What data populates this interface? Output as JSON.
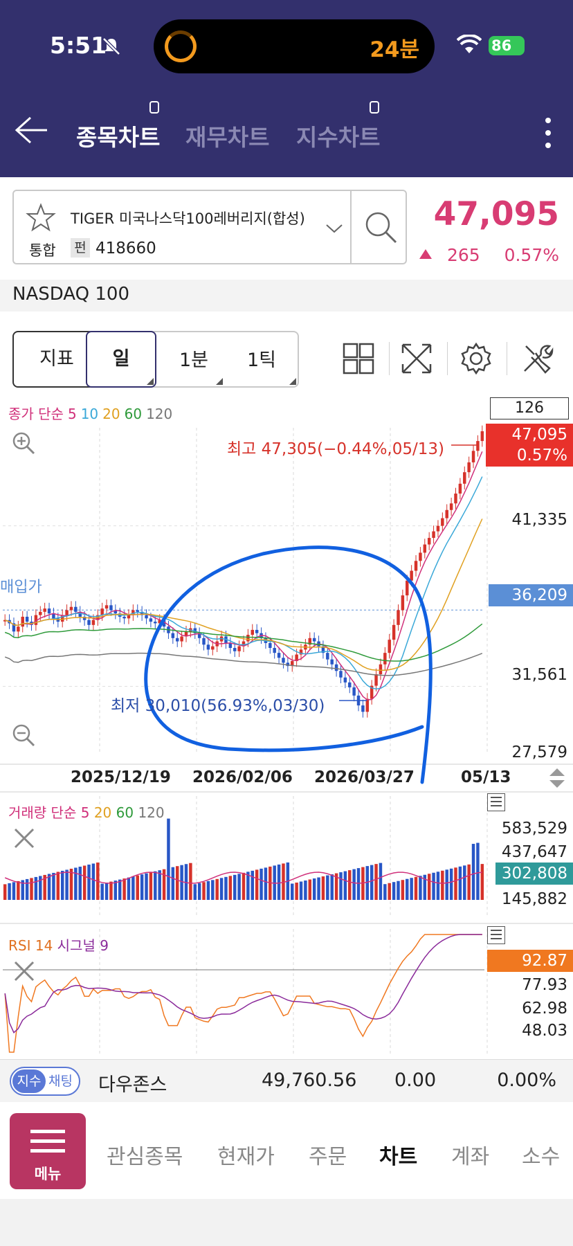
{
  "status": {
    "time": "5:51",
    "island_text": "24분",
    "battery": "86"
  },
  "header": {
    "tabs": [
      {
        "label": "종목차트"
      },
      {
        "label": "재무차트"
      },
      {
        "label": "지수차트"
      }
    ]
  },
  "stock": {
    "name": "TIGER 미국나스닥100레버리지(합성)",
    "market": "통합",
    "fund_badge": "펀",
    "code": "418660",
    "price": "47,095",
    "change": "265",
    "change_pct": "0.57%",
    "index_name": "NASDAQ 100"
  },
  "toolbar": {
    "indicator": "지표",
    "day": "일",
    "minute": "1분",
    "tick": "1틱"
  },
  "chart": {
    "legend": {
      "prefix": "종가 단순",
      "ma": [
        "5",
        "10",
        "20",
        "60",
        "120"
      ]
    },
    "count": "126",
    "high_label": "최고 47,305(−0.44%,05/13)",
    "low_label": "최저 30,010(56.93%,03/30)",
    "avg_label": "매입가",
    "price_tag": "47,095",
    "pct_tag": "0.57%",
    "avg_tag": "36,209",
    "y_ticks": [
      "41,335",
      "31,561",
      "27,579"
    ],
    "dates": [
      "2025/12/19",
      "2026/02/06",
      "2026/03/27",
      "05/13"
    ]
  },
  "volume": {
    "legend_prefix": "거래량 단순",
    "ma": [
      "5",
      "20",
      "60",
      "120"
    ],
    "ticks": [
      "583,529",
      "437,647",
      "145,882"
    ],
    "tag": "302,808"
  },
  "rsi": {
    "legend_a": "RSI 14",
    "legend_b": "시그널 9",
    "tag": "92.87",
    "ticks": [
      "77.93",
      "62.98",
      "48.03"
    ]
  },
  "chart_data": {
    "type": "candlestick",
    "title": "TIGER 미국나스닥100레버리지(합성)",
    "x_dates": [
      "2025/12/19",
      "2026/02/06",
      "2026/03/27",
      "05/13"
    ],
    "y_range": [
      27579,
      47305
    ],
    "high": {
      "value": 47305,
      "date": "05/13"
    },
    "low": {
      "value": 30010,
      "date": "03/30"
    },
    "last": 47095,
    "avg_price": 36209,
    "closes": [
      35600,
      35400,
      34900,
      35200,
      35800,
      35500,
      35300,
      35900,
      36100,
      36300,
      36000,
      35700,
      35500,
      35900,
      36200,
      36400,
      36100,
      35800,
      35600,
      35300,
      35600,
      35900,
      36300,
      36500,
      36200,
      36000,
      35800,
      35700,
      35900,
      36200,
      36100,
      35900,
      35700,
      35500,
      35400,
      35600,
      35200,
      34800,
      34500,
      34300,
      34600,
      34900,
      35100,
      34800,
      34500,
      34100,
      33800,
      34000,
      34300,
      34600,
      34200,
      33900,
      33700,
      34000,
      34300,
      34700,
      35000,
      34800,
      34500,
      34200,
      33900,
      33600,
      33300,
      33000,
      32800,
      33100,
      33500,
      33800,
      34100,
      34500,
      34300,
      34000,
      33600,
      33200,
      32900,
      32500,
      32100,
      31800,
      31500,
      31000,
      30400,
      30010,
      30800,
      31600,
      32300,
      32900,
      33600,
      34400,
      35300,
      36200,
      37100,
      38000,
      38600,
      39200,
      39700,
      40200,
      40600,
      41000,
      41335,
      41800,
      42300,
      42700,
      43300,
      43900,
      44600,
      45200,
      45900,
      46500,
      47095
    ],
    "volume_ticks": [
      583529,
      437647,
      145882
    ],
    "volume_last": 302808,
    "rsi_last": 92.87,
    "rsi_ticks": [
      77.93,
      62.98,
      48.03
    ],
    "colors": {
      "up": "#d6322a",
      "down": "#2856c6",
      "ma5": "#d0307a",
      "ma10": "#3aa8d8",
      "ma20": "#e0a020",
      "ma60": "#2e9a3a",
      "ma120": "#777777",
      "annotation": "#1160e0"
    }
  }
}
